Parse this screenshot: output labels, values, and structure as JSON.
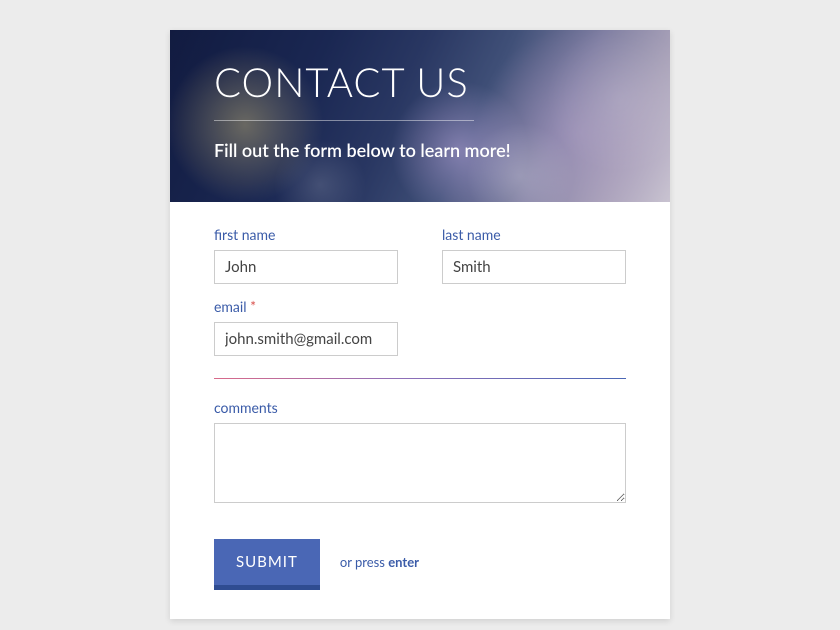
{
  "header": {
    "title": "CONTACT US",
    "subtitle": "Fill out the form below to learn more!"
  },
  "form": {
    "first_name": {
      "label": "first name",
      "value": "John"
    },
    "last_name": {
      "label": "last name",
      "value": "Smith"
    },
    "email": {
      "label": "email",
      "value": "john.smith@gmail.com",
      "required_marker": "*"
    },
    "comments": {
      "label": "comments",
      "value": ""
    }
  },
  "footer": {
    "submit_label": "SUBMIT",
    "hint_prefix": "or press ",
    "hint_key": "enter"
  }
}
